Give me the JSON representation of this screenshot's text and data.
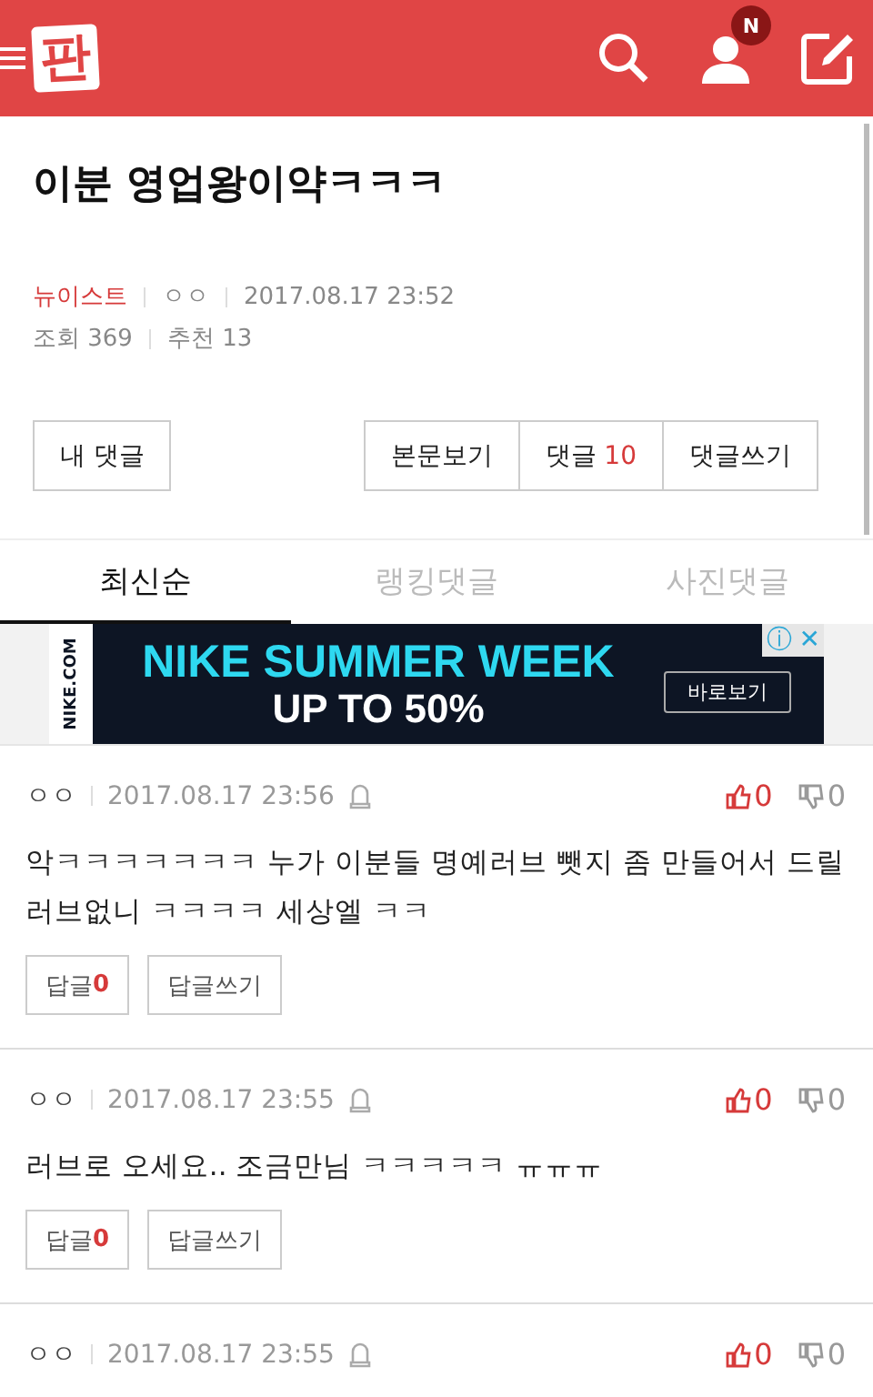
{
  "header": {
    "logo": "판",
    "notification_badge": "N"
  },
  "post": {
    "title": "이분 영업왕이약ㅋㅋㅋ",
    "category": "뉴이스트",
    "author": "ㅇㅇ",
    "date": "2017.08.17 23:52",
    "views_label": "조회",
    "views": "369",
    "recommend_label": "추천",
    "recommends": "13"
  },
  "actions": {
    "my_comments": "내 댓글",
    "view_post": "본문보기",
    "comments_label": "댓글",
    "comments_count": "10",
    "write_comment": "댓글쓰기"
  },
  "tabs": [
    {
      "label": "최신순",
      "selected": true
    },
    {
      "label": "랭킹댓글",
      "selected": false
    },
    {
      "label": "사진댓글",
      "selected": false
    }
  ],
  "ad": {
    "brand": "NIKE.COM",
    "headline": "NIKE SUMMER WEEK",
    "subline": "UP TO 50%",
    "button": "바로보기",
    "info": "ⓘ",
    "close": "✕"
  },
  "comments": [
    {
      "author": "ㅇㅇ",
      "date": "2017.08.17 23:56",
      "likes": "0",
      "dislikes": "0",
      "text": "악ㅋㅋㅋㅋㅋㅋㅋ 누가 이분들 명예러브 뺏지 좀 만들어서 드릴 러브없니 ㅋㅋㅋㅋ 세상엘 ㅋㅋ",
      "reply_label": "답글",
      "reply_count": "0",
      "write_reply": "답글쓰기"
    },
    {
      "author": "ㅇㅇ",
      "date": "2017.08.17 23:55",
      "likes": "0",
      "dislikes": "0",
      "text": "러브로 오세요.. 조금만님 ㅋㅋㅋㅋㅋ ㅠㅠㅠ",
      "reply_label": "답글",
      "reply_count": "0",
      "write_reply": "답글쓰기"
    },
    {
      "author": "ㅇㅇ",
      "date": "2017.08.17 23:55",
      "likes": "0",
      "dislikes": "0"
    }
  ]
}
